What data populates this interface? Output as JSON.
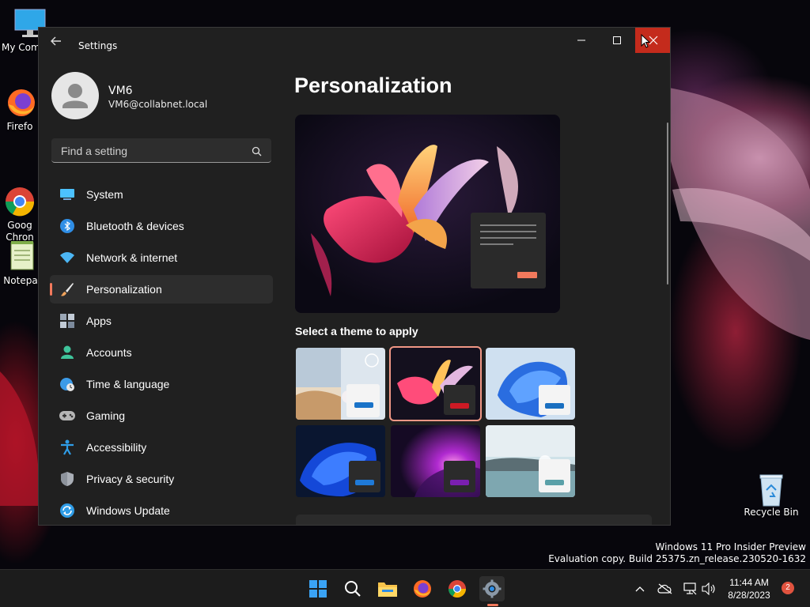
{
  "desktop": {
    "icons": [
      {
        "label": "My Com",
        "icon": "this-pc-icon"
      },
      {
        "label": "Firefo",
        "icon": "firefox-icon"
      },
      {
        "label": "Goog\nChron",
        "icon": "chrome-icon"
      },
      {
        "label": "Notepa",
        "icon": "notepad-icon"
      },
      {
        "label": "Recycle Bin",
        "icon": "recycle-bin-icon"
      }
    ],
    "watermark": {
      "line1": "Windows 11 Pro Insider Preview",
      "line2": "Evaluation copy. Build 25375.zn_release.230520-1632"
    }
  },
  "window": {
    "title": "Settings",
    "controls": {
      "minimize": "minimize-icon",
      "maximize": "maximize-icon",
      "close": "close-icon"
    }
  },
  "user": {
    "name": "VM6",
    "email": "VM6@collabnet.local"
  },
  "search": {
    "placeholder": "Find a setting",
    "value": ""
  },
  "sidebar": {
    "items": [
      {
        "label": "System",
        "icon": "system-icon",
        "color": "#4cc2ff",
        "active": false
      },
      {
        "label": "Bluetooth & devices",
        "icon": "bluetooth-icon",
        "color": "#2f8ee6",
        "active": false
      },
      {
        "label": "Network & internet",
        "icon": "wifi-icon",
        "color": "#4cb6f4",
        "active": false
      },
      {
        "label": "Personalization",
        "icon": "brush-icon",
        "color": "#f0a35c",
        "active": true
      },
      {
        "label": "Apps",
        "icon": "apps-icon",
        "color": "#9aa6b5",
        "active": false
      },
      {
        "label": "Accounts",
        "icon": "accounts-icon",
        "color": "#3fc49b",
        "active": false
      },
      {
        "label": "Time & language",
        "icon": "globe-clock-icon",
        "color": "#3c9be8",
        "active": false
      },
      {
        "label": "Gaming",
        "icon": "gamepad-icon",
        "color": "#a8a8a8",
        "active": false
      },
      {
        "label": "Accessibility",
        "icon": "accessibility-icon",
        "color": "#2f9de8",
        "active": false
      },
      {
        "label": "Privacy & security",
        "icon": "shield-icon",
        "color": "#a9aeb6",
        "active": false
      },
      {
        "label": "Windows Update",
        "icon": "update-icon",
        "color": "#2f9de8",
        "active": false
      }
    ]
  },
  "main": {
    "title": "Personalization",
    "theme_section_label": "Select a theme to apply",
    "themes": [
      {
        "name": "theme-windows-spotlight",
        "accent": "#1a73c8",
        "selected": false
      },
      {
        "name": "theme-glow",
        "accent": "#cc1a24",
        "selected": true
      },
      {
        "name": "theme-windows-light",
        "accent": "#1a6fc0",
        "selected": false
      },
      {
        "name": "theme-windows-dark",
        "accent": "#1f7ad8",
        "selected": false
      },
      {
        "name": "theme-captured-motion",
        "accent": "#7a1fb0",
        "selected": false
      },
      {
        "name": "theme-flow",
        "accent": "#5aa0a8",
        "selected": false
      }
    ]
  },
  "taskbar": {
    "apps": [
      {
        "name": "start-button",
        "icon": "windows-logo-icon"
      },
      {
        "name": "search-button",
        "icon": "search-icon"
      },
      {
        "name": "file-explorer-button",
        "icon": "folder-icon"
      },
      {
        "name": "firefox-button",
        "icon": "firefox-icon"
      },
      {
        "name": "chrome-button",
        "icon": "chrome-icon"
      },
      {
        "name": "settings-button",
        "icon": "gear-icon",
        "active": true
      }
    ],
    "clock": {
      "time": "11:44 AM",
      "date": "8/28/2023"
    },
    "notification_count": "2",
    "accent_color": "#f2795c"
  }
}
